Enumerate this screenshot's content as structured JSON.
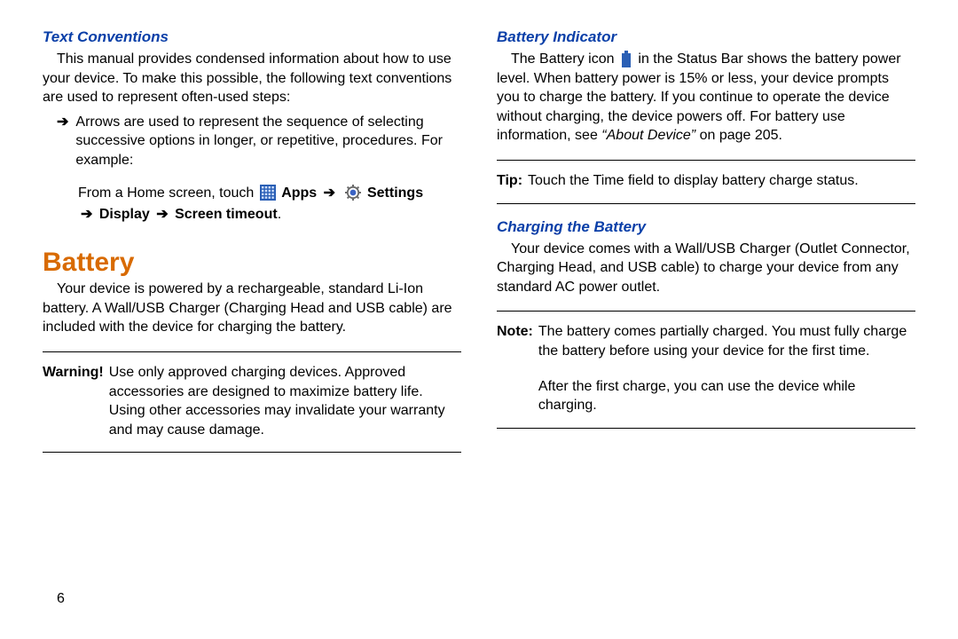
{
  "page_number": "6",
  "left": {
    "text_conventions": {
      "heading": "Text Conventions",
      "para": "This manual provides condensed information about how to use your device. To make this possible, the following text conventions are used to represent often-used steps:",
      "bullet_arrow": "➔",
      "bullet_text": "Arrows are used to represent the sequence of selecting successive options in longer, or repetitive, procedures. For example:",
      "from_prefix": "From a Home screen, touch",
      "apps_label": "Apps",
      "settings_label": "Settings",
      "display_label": "Display",
      "screen_timeout_label": "Screen timeout",
      "arrow": "➔",
      "period": "."
    },
    "battery": {
      "heading": "Battery",
      "para": "Your device is powered by a rechargeable, standard Li-Ion battery. A Wall/USB Charger (Charging Head and USB cable) are included with the device for charging the battery.",
      "warning_label": "Warning!",
      "warning_text": "Use only approved charging devices. Approved accessories are designed to maximize battery life. Using other accessories may invalidate your warranty and may cause damage."
    }
  },
  "right": {
    "battery_indicator": {
      "heading": "Battery Indicator",
      "para_before_icon": "The Battery icon",
      "para_after_icon": "in the Status Bar shows the battery power level. When battery power is 15% or less, your device prompts you to charge the battery. If you continue to operate the device without charging, the device powers off. For battery use information, see",
      "about_device_quote": "“About Device”",
      "on_page": "on page 205.",
      "tip_label": "Tip:",
      "tip_text": "Touch the Time field to display battery charge status."
    },
    "charging": {
      "heading": "Charging the Battery",
      "para": "Your device comes with a Wall/USB Charger (Outlet Connector, Charging Head, and USB cable) to charge your device from any standard AC power outlet.",
      "note_label": "Note:",
      "note_text": "The battery comes partially charged. You must fully charge the battery before using your device for the first time.",
      "after_text": "After the first charge, you can use the device while charging."
    }
  }
}
